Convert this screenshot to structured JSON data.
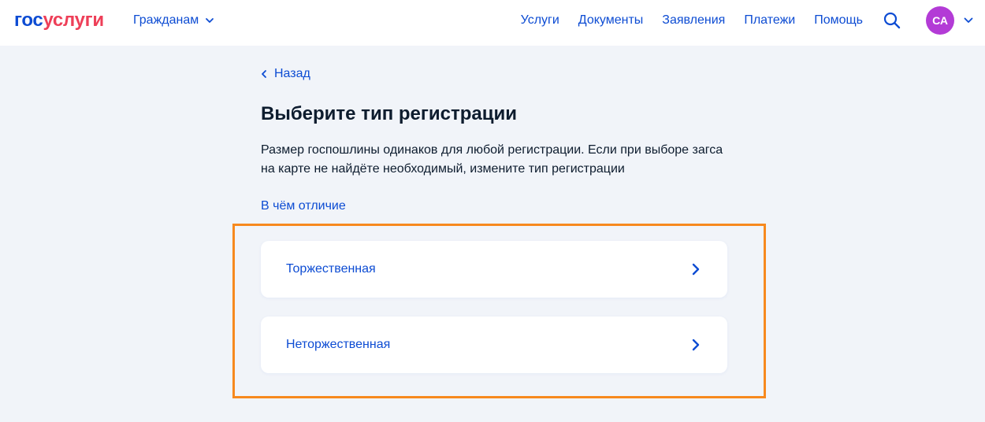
{
  "header": {
    "logo_part1": "гос",
    "logo_part2": "услуги",
    "audience": "Гражданам",
    "nav": [
      "Услуги",
      "Документы",
      "Заявления",
      "Платежи",
      "Помощь"
    ],
    "avatar_initials": "СА"
  },
  "page": {
    "back_label": "Назад",
    "title": "Выберите тип регистрации",
    "description": "Размер госпошлины одинаков для любой регистрации. Если при выборе загса на карте не найдёте необходимый, измените тип регистрации",
    "difference_link": "В чём отличие",
    "options": [
      {
        "label": "Торжественная"
      },
      {
        "label": "Неторжественная"
      }
    ]
  },
  "colors": {
    "brand_blue": "#0d4cd3",
    "brand_red": "#ee3f58",
    "highlight": "#f7891e",
    "avatar_bg": "#b33bd6",
    "page_bg": "#f1f4f9"
  },
  "icons": {
    "audience": "chevron-down-icon",
    "search": "search-icon",
    "avatar_menu": "chevron-down-icon",
    "back": "chevron-left-icon",
    "option": "chevron-right-icon"
  }
}
